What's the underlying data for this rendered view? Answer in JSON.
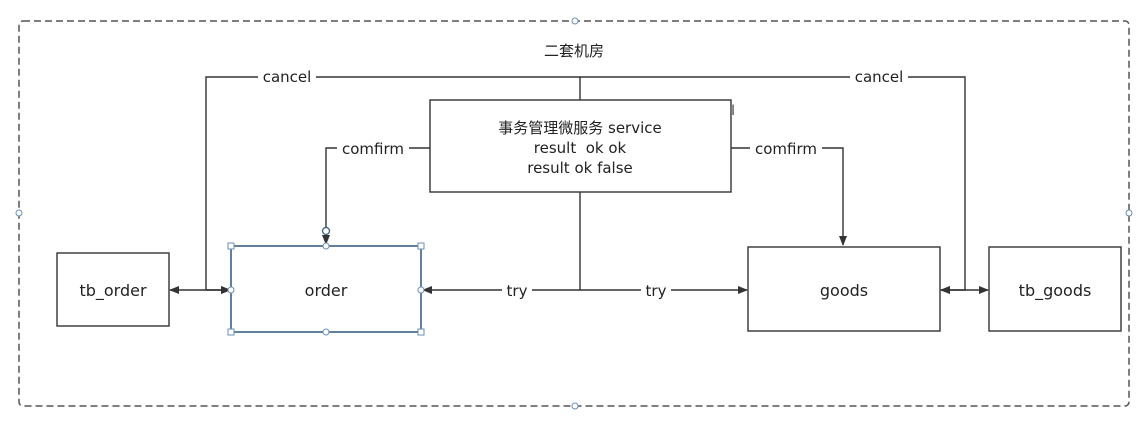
{
  "container": {
    "title": "二套机房"
  },
  "nodes": {
    "service": {
      "lines": [
        "事务管理微服务 service",
        "result  ok ok",
        "result ok false"
      ]
    },
    "tb_order": {
      "label": "tb_order"
    },
    "order": {
      "label": "order"
    },
    "goods": {
      "label": "goods"
    },
    "tb_goods": {
      "label": "tb_goods"
    }
  },
  "edges": {
    "cancel_left": "cancel",
    "cancel_right": "cancel",
    "confirm_left": "comfirm",
    "confirm_right": "comfirm",
    "try_left": "try",
    "try_right": "try"
  },
  "colors": {
    "line": "#333333",
    "container_border": "#555555",
    "selection": "#6a8fb5"
  }
}
